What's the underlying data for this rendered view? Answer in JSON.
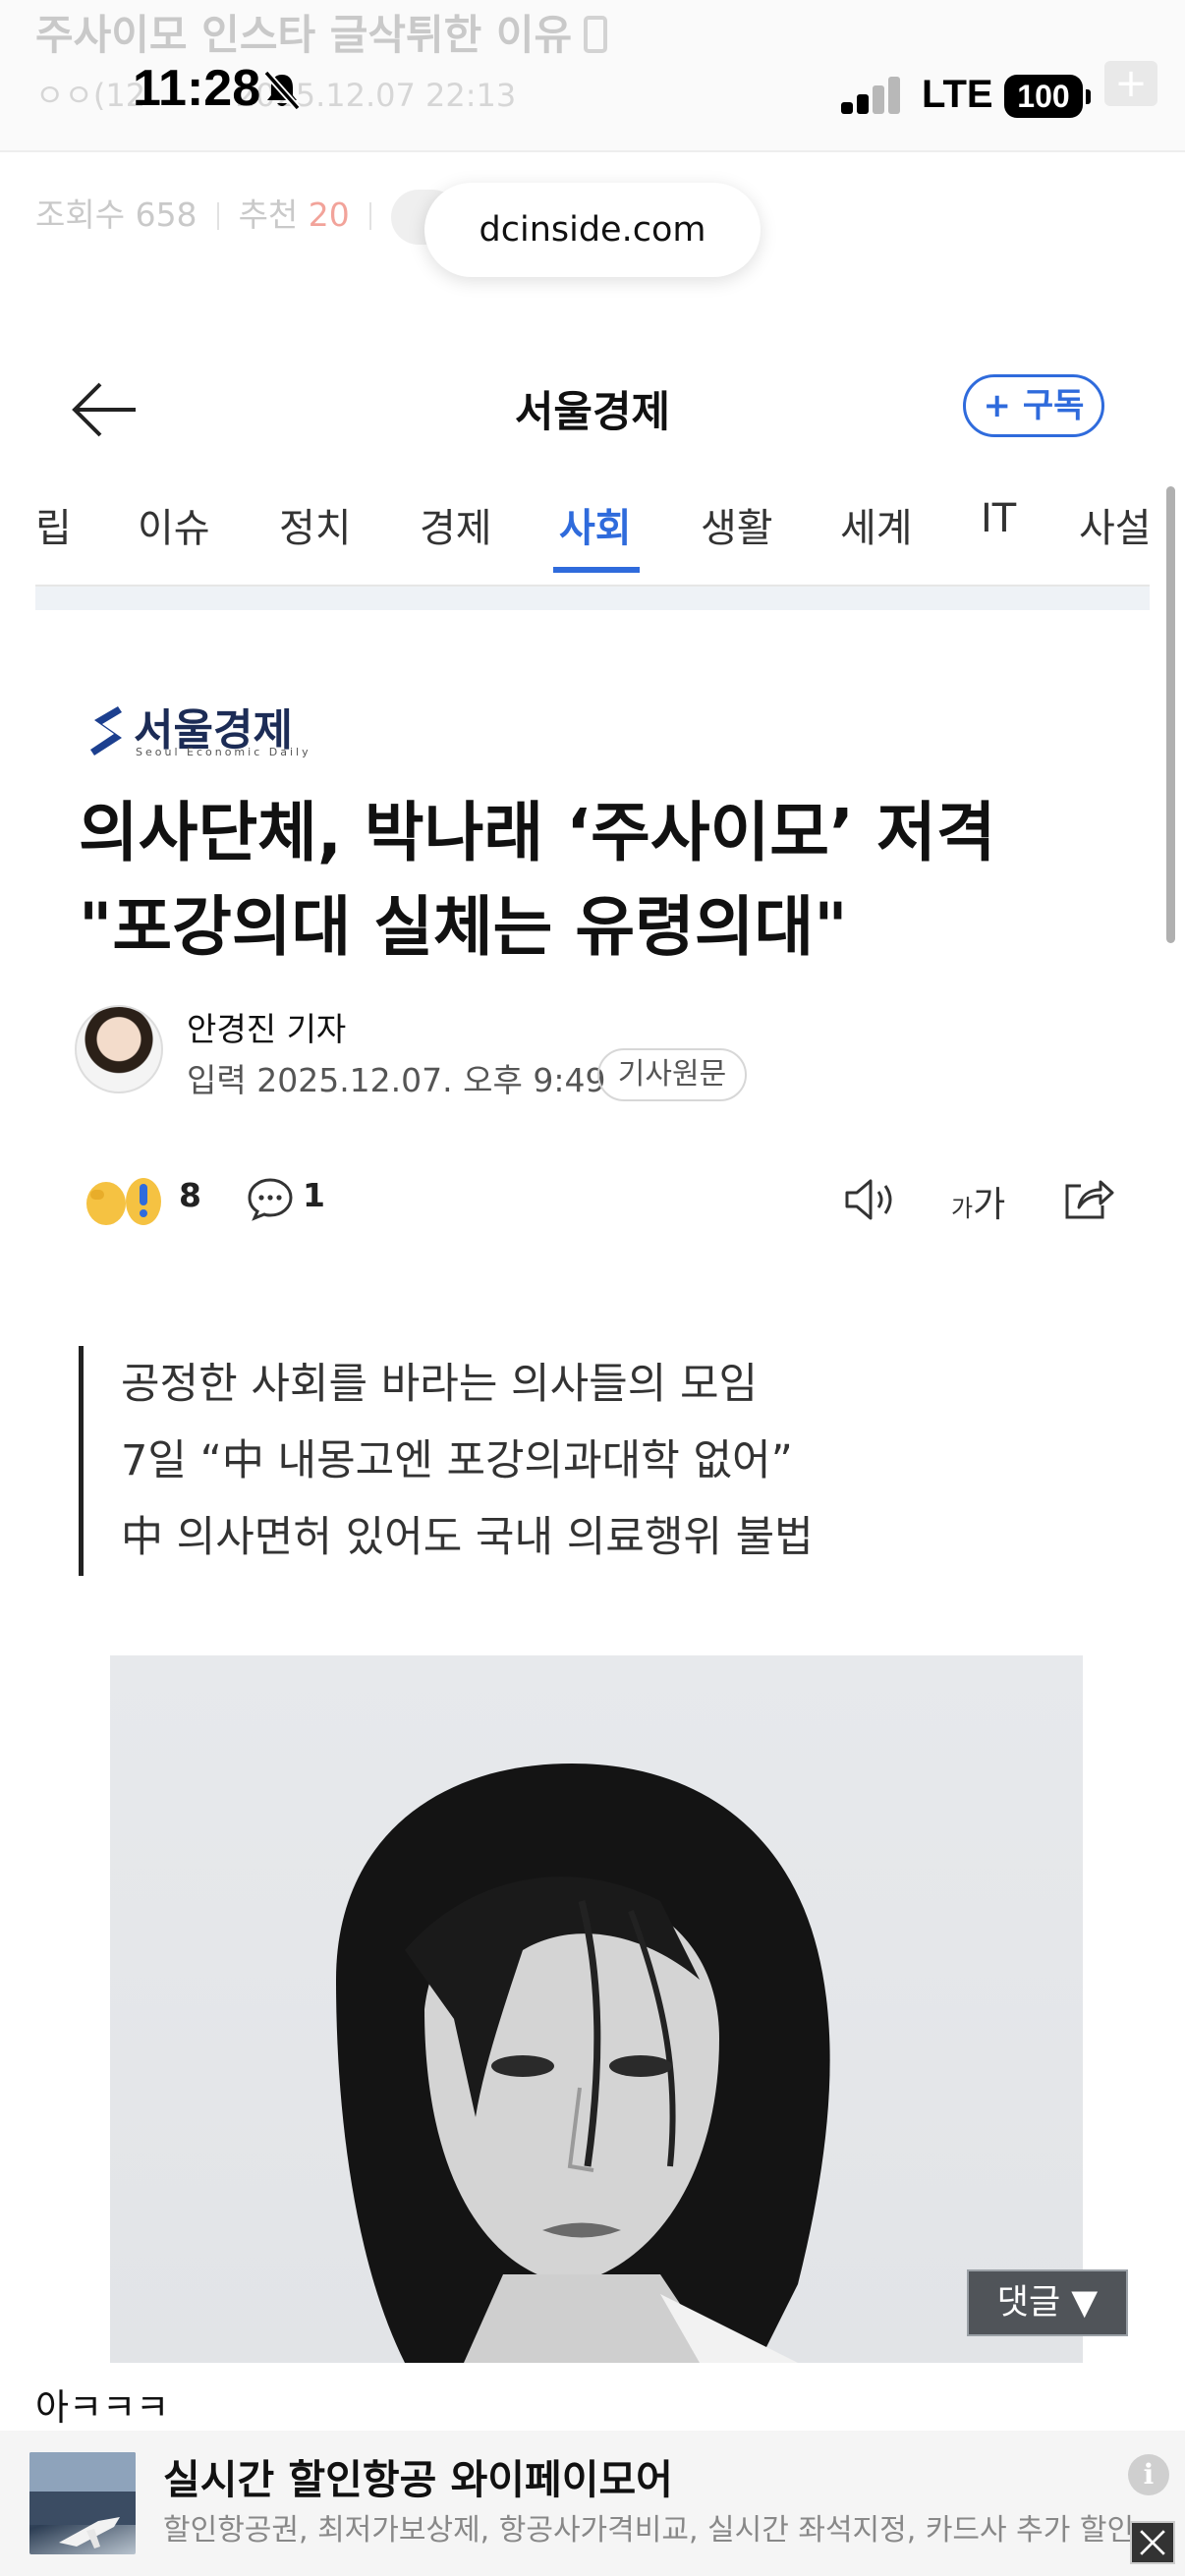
{
  "background_page": {
    "post_title": "주사이모 인스타 글삭튀한 이유",
    "author_meta": "ㅇㅇ(12",
    "post_datetime": "2025.12.07 22:13",
    "views_label": "조회수 658",
    "recommend_label": "추천",
    "recommend_count": "20"
  },
  "status_bar": {
    "time": "11:28",
    "network": "LTE",
    "battery": "100"
  },
  "browser": {
    "url": "dcinside.com"
  },
  "article_header": {
    "outlet": "서울경제",
    "subscribe_label": "+ 구독"
  },
  "tabs": [
    {
      "label": "립"
    },
    {
      "label": "이슈"
    },
    {
      "label": "정치"
    },
    {
      "label": "경제"
    },
    {
      "label": "사회"
    },
    {
      "label": "생활"
    },
    {
      "label": "세계"
    },
    {
      "label": "IT"
    },
    {
      "label": "사설"
    }
  ],
  "active_tab": "사회",
  "logo": {
    "name": "서울경제",
    "subtitle": "Seoul Economic Daily"
  },
  "article": {
    "headline_line1": "의사단체, 박나래 ‘주사이모’ 저격",
    "headline_line2": "\"포강의대 실체는 유령의대\"",
    "reporter": "안경진 기자",
    "dateline": "입력 2025.12.07. 오후 9:49",
    "original_label": "기사원문",
    "reaction_count": "8",
    "comment_count": "1",
    "font_small": "가",
    "font_large": "가",
    "summary": [
      "공정한 사회를 바라는 의사들의 모임",
      "7일 “中 내몽고엔 포강의과대학 없어”",
      "中 의사면허 있어도 국내 의료행위 불법"
    ]
  },
  "comment_button_label": "댓글 ▼",
  "post_body_text": "아ㅋㅋㅋ",
  "ad": {
    "title": "실시간 할인항공 와이페이모어",
    "description": "할인항공권, 최저가보상제, 항공사가격비교, 실시간 좌석지정, 카드사 추가 할인"
  },
  "colors": {
    "accent": "#2f6bdc",
    "recommend_red": "#f2a39a"
  }
}
